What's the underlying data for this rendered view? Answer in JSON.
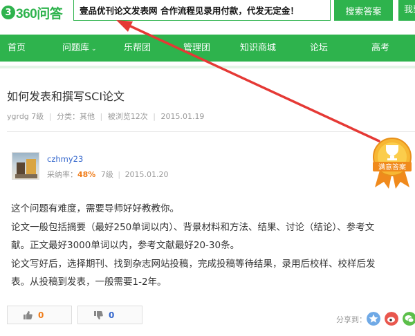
{
  "header": {
    "logo_mark": "3",
    "logo_text": "360问答",
    "search_value": "壹品优刊论文发表网 合作流程见录用付款，代发无定金！",
    "search_button": "搜索答案",
    "ask_button": "我要提问"
  },
  "nav": {
    "items": [
      "首页",
      "问题库",
      "乐帮团",
      "管理团",
      "知识商城",
      "论坛",
      "高考"
    ],
    "dropdown_icon": "chevron-down-icon"
  },
  "question": {
    "title": "如何发表和撰写SCI论文",
    "author": "ygrdg",
    "level": "7级",
    "category": "分类：其他",
    "views": "被浏览12次",
    "date": "2015.01.19"
  },
  "answer": {
    "user": "czhmy23",
    "rate_label": "采纳率：",
    "rate": "48%",
    "level": "7级",
    "date": "2015.01.20",
    "badge": "满意答案",
    "lines": [
      "这个问题有难度，需要导师好好教教你。",
      "论文一般包括摘要（最好250单词以内）、背景材料和方法、结果、讨论（结论）、参考文",
      "献。正文最好3000单词以内，参考文献最好20-30条。",
      "论文写好后，选择期刊、找到杂志网站投稿，完成投稿等待结果，录用后校样、校样后发",
      "表。从投稿到发表，一般需要1-2年。"
    ],
    "upvotes": "0",
    "downvotes": "0",
    "share_label": "分享到："
  },
  "colors": {
    "brand": "#2eb34d",
    "annotation_arrow": "#e53935",
    "badge": "#f5a623"
  }
}
